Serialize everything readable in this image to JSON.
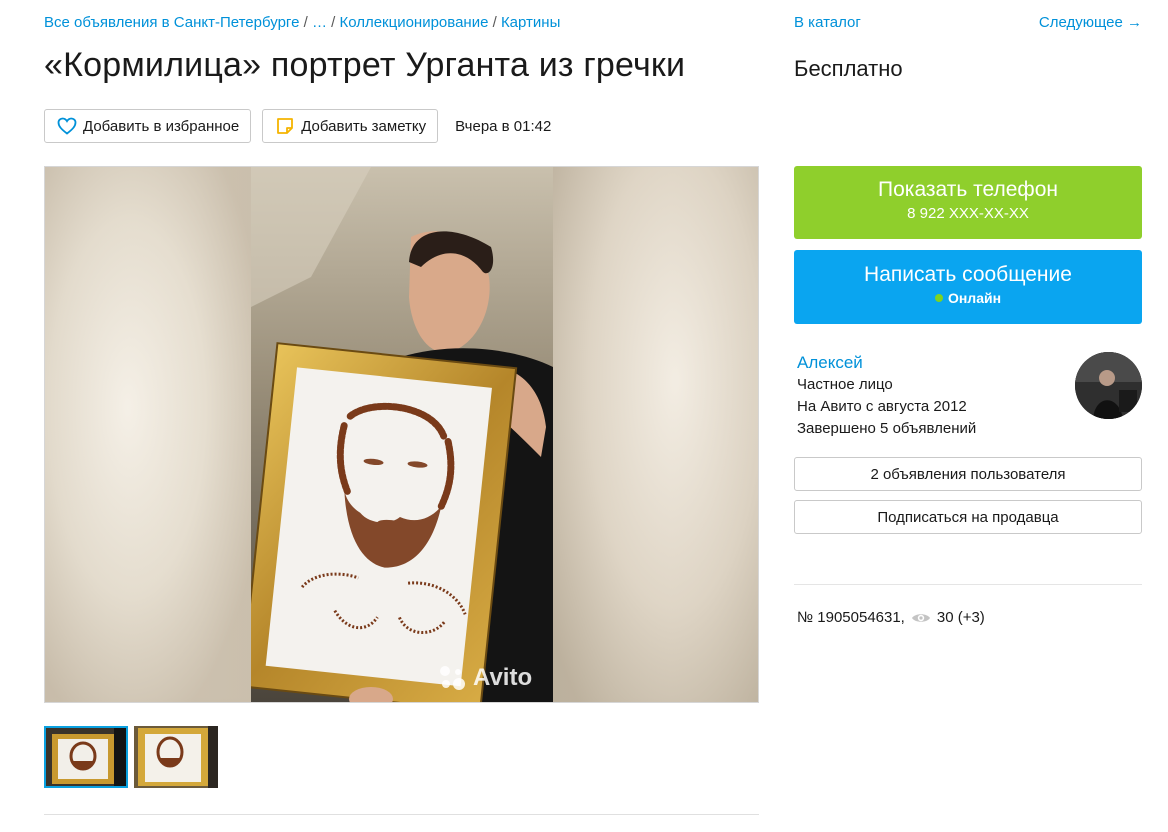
{
  "breadcrumb": {
    "items": [
      "Все объявления в Санкт-Петербурге",
      "…",
      "Коллекционирование",
      "Картины"
    ],
    "separator": " / "
  },
  "listing": {
    "title": "«Кормилица» портрет Урганта из гречки",
    "favorite_label": "Добавить в избранное",
    "note_label": "Добавить заметку",
    "posted": "Вчера в 01:42",
    "watermark": "Avito"
  },
  "sidebar": {
    "catalog_label": "В каталог",
    "next_label": "Следующее →",
    "price": "Бесплатно",
    "phone_button": {
      "label": "Показать телефон",
      "number": "8 922 XXX-XX-XX"
    },
    "message_button": {
      "label": "Написать сообщение",
      "status": "Онлайн"
    },
    "seller": {
      "name": "Алексей",
      "type": "Частное лицо",
      "since": "На Авито с августа 2012",
      "completed": "Завершено 5 объявлений"
    },
    "user_ads_label": "2 объявления пользователя",
    "subscribe_label": "Подписаться на продавца",
    "ad_number": "№ 1905054631,",
    "views": "30 (+3)"
  },
  "colors": {
    "link": "#0091d9",
    "phone_button": "#8fcf2c",
    "message_button": "#0aa5f0",
    "online": "#7ed321"
  }
}
